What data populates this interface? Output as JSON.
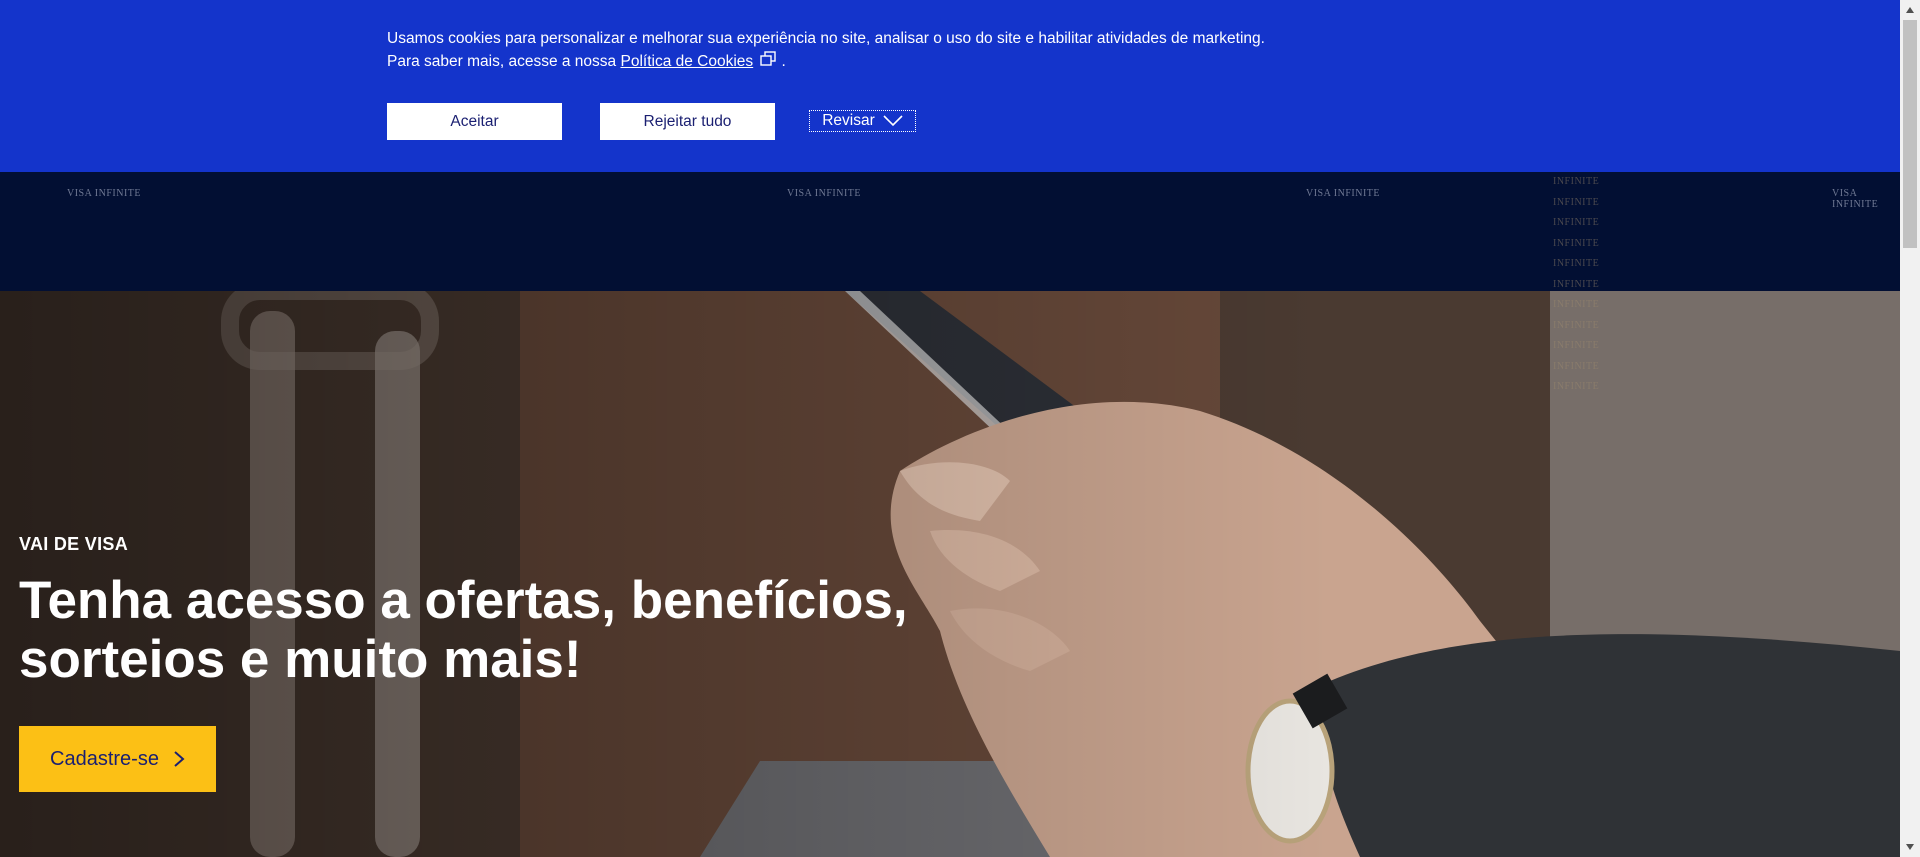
{
  "cookie_banner": {
    "text": "Usamos cookies para personalizar e melhorar sua experiência no site, analisar o uso do site e habilitar atividades de marketing. Para saber mais, acesse a nossa",
    "link_label": "Política de Cookies",
    "text_end": ".",
    "accept_label": "Aceitar",
    "reject_label": "Rejeitar tudo",
    "review_label": "Revisar"
  },
  "brand_band": {
    "wordmark": "VISA INFINITE",
    "infinite_word": "INFINITE"
  },
  "hero": {
    "eyebrow": "VAI DE VISA",
    "headline": "Tenha acesso a ofertas, benefícios, sorteios e muito mais!",
    "cta_label": "Cadastre-se"
  },
  "colors": {
    "banner_blue": "#1434cb",
    "dark_navy": "#020f33",
    "cta_yellow": "#fcc015",
    "visa_navy_text": "#1a1f71"
  },
  "icons": [
    "external-link-icon",
    "chevron-down-icon",
    "chevron-right-icon"
  ]
}
